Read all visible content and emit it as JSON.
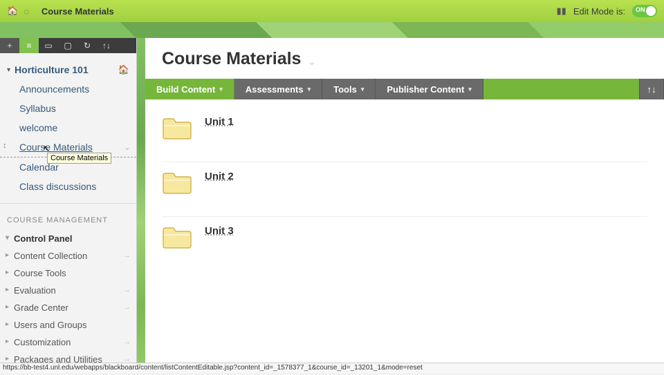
{
  "topbar": {
    "breadcrumb": "Course Materials",
    "edit_mode_label": "Edit Mode is:",
    "edit_mode_state": "ON"
  },
  "sidebar": {
    "course_title": "Horticulture 101",
    "menu_items": [
      {
        "label": "Announcements"
      },
      {
        "label": "Syllabus"
      },
      {
        "label": "welcome"
      },
      {
        "label": "Course Materials",
        "current": true,
        "tooltip": "Course Materials"
      },
      {
        "label": "Calendar"
      },
      {
        "label": "Class discussions"
      }
    ],
    "mgmt_header": "COURSE MANAGEMENT",
    "mgmt_items": [
      {
        "label": "Control Panel",
        "bold": true
      },
      {
        "label": "Content Collection"
      },
      {
        "label": "Course Tools"
      },
      {
        "label": "Evaluation"
      },
      {
        "label": "Grade Center"
      },
      {
        "label": "Users and Groups"
      },
      {
        "label": "Customization"
      },
      {
        "label": "Packages and Utilities"
      }
    ]
  },
  "page": {
    "title": "Course Materials"
  },
  "actionbar": {
    "build_content": "Build Content",
    "assessments": "Assessments",
    "tools": "Tools",
    "publisher": "Publisher Content"
  },
  "content": {
    "units": [
      {
        "title": "Unit 1"
      },
      {
        "title": "Unit 2"
      },
      {
        "title": "Unit 3"
      }
    ]
  },
  "statusbar": {
    "url": "https://bb-test4.unl.edu/webapps/blackboard/content/listContentEditable.jsp?content_id=_1578377_1&course_id=_13201_1&mode=reset"
  }
}
